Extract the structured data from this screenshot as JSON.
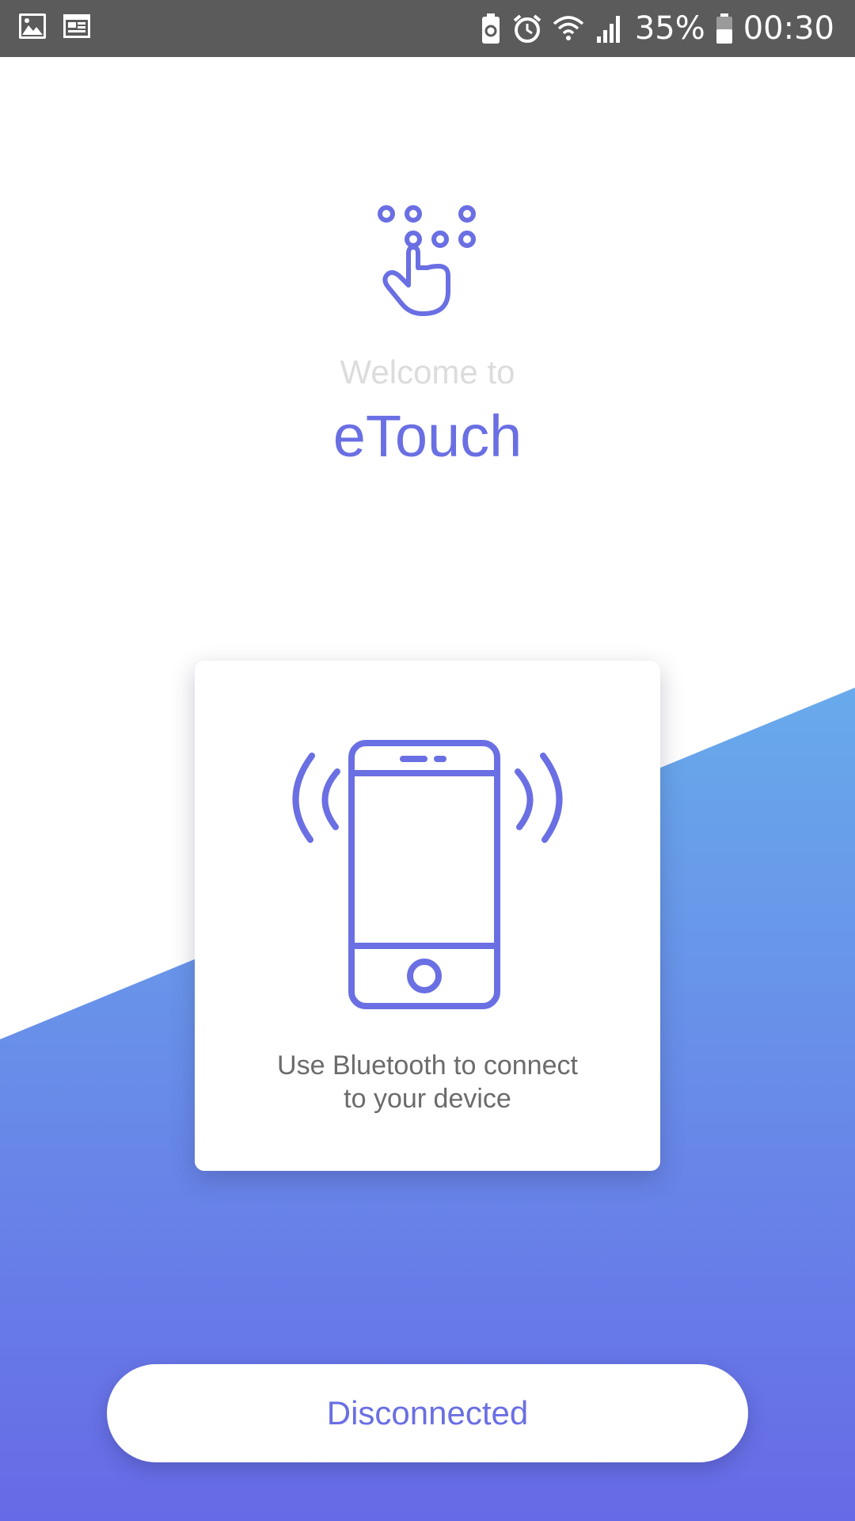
{
  "status_bar": {
    "left_icons": [
      "image-icon",
      "calendar-icon"
    ],
    "right_icons": [
      "battery-saver-icon",
      "alarm-icon",
      "wifi-icon",
      "signal-icon",
      "battery-icon"
    ],
    "battery_percent": "35%",
    "time": "00:30"
  },
  "header": {
    "logo_icon": "touch-dots-icon",
    "welcome": "Welcome to",
    "title": "eTouch"
  },
  "card": {
    "illustration_icon": "vibrating-phone-icon",
    "message_line1": "Use Bluetooth to connect",
    "message_line2": "to your device"
  },
  "connection_button": {
    "label": "Disconnected"
  },
  "colors": {
    "accent": "#6a6fe3",
    "gradient_top": "#68aaeb",
    "gradient_bottom": "#676ae6",
    "status_bar": "#5b5b5b",
    "welcome_text": "#dcdcdc",
    "card_text": "#6b6b6b"
  }
}
